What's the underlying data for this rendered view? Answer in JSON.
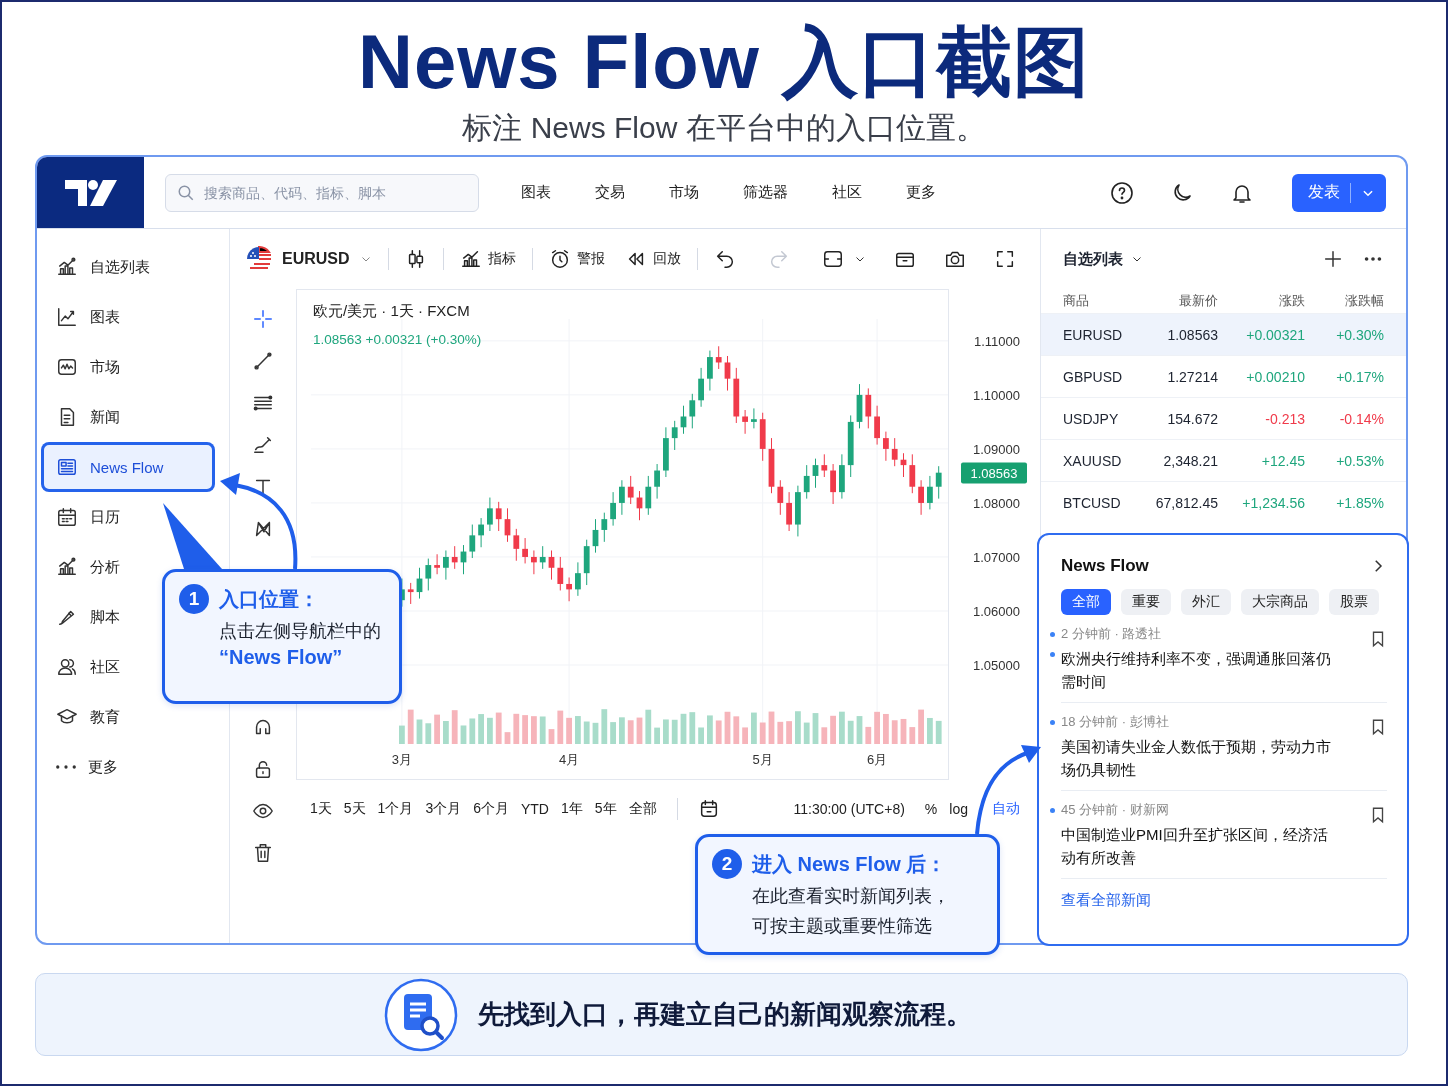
{
  "header": {
    "title": "News Flow 入口截图",
    "subtitle": "标注 News Flow 在平台中的入口位置。"
  },
  "topbar": {
    "search": {
      "placeholder": "搜索商品、代码、指标、脚本"
    },
    "nav": [
      "图表",
      "交易",
      "市场",
      "筛选器",
      "社区",
      "更多"
    ],
    "publish_button": "发表"
  },
  "sidebar": {
    "items": [
      {
        "kind": "watchlist",
        "label": "自选列表",
        "selected": false
      },
      {
        "kind": "chart",
        "label": "图表",
        "selected": false
      },
      {
        "kind": "market",
        "label": "市场",
        "selected": false
      },
      {
        "kind": "news",
        "label": "新闻",
        "selected": false
      },
      {
        "kind": "newsflow",
        "label": "News Flow",
        "selected": true
      },
      {
        "kind": "calendar",
        "label": "日历",
        "selected": false
      },
      {
        "kind": "analysis",
        "label": "分析",
        "selected": false
      },
      {
        "kind": "script",
        "label": "脚本",
        "selected": false
      },
      {
        "kind": "community",
        "label": "社区",
        "selected": false
      },
      {
        "kind": "education",
        "label": "教育",
        "selected": false
      },
      {
        "kind": "more",
        "label": "更多",
        "selected": false
      }
    ]
  },
  "chart_toolbar": {
    "symbol": "EURUSD",
    "indicators": "指标",
    "alert": "警报",
    "replay": "回放",
    "undo": {
      "disabled": false
    },
    "redo": {
      "disabled": true
    }
  },
  "drawing_tools": [
    {
      "kind": "crosshair",
      "selected": true
    },
    {
      "kind": "trendline",
      "selected": false
    },
    {
      "kind": "fib",
      "selected": false
    },
    {
      "kind": "brush",
      "selected": false
    },
    {
      "kind": "text",
      "selected": false
    },
    {
      "kind": "pattern",
      "selected": false
    },
    {
      "kind": "magnet",
      "selected": false
    },
    {
      "kind": "lock",
      "selected": false
    },
    {
      "kind": "eye",
      "selected": false
    },
    {
      "kind": "trash",
      "selected": false
    }
  ],
  "chart": {
    "title": "欧元/美元 · 1天 · FXCM",
    "price": "1.08563",
    "change": "+0.00321 (+0.30%)",
    "last_price": "1.08563",
    "chart_data": {
      "type": "candlestick",
      "ylim": [
        1.0289,
        1.1196
      ],
      "grid": true,
      "yticks": [
        {
          "value": 1.11,
          "label": "1.11000"
        },
        {
          "value": 1.1,
          "label": "1.10000"
        },
        {
          "value": 1.09,
          "label": "1.09000"
        },
        {
          "value": 1.08,
          "label": "1.08000"
        },
        {
          "value": 1.07,
          "label": "1.07000"
        },
        {
          "value": 1.06,
          "label": "1.06000"
        },
        {
          "value": 1.05,
          "label": "1.05000"
        }
      ],
      "categories": [
        "3月",
        null,
        null,
        null,
        null,
        null,
        null,
        null,
        null,
        null,
        null,
        null,
        null,
        null,
        null,
        null,
        null,
        null,
        null,
        "4月",
        null,
        null,
        null,
        null,
        null,
        null,
        null,
        null,
        null,
        null,
        null,
        null,
        null,
        null,
        null,
        null,
        null,
        null,
        null,
        null,
        null,
        "5月",
        null,
        null,
        null,
        null,
        null,
        null,
        null,
        null,
        null,
        null,
        null,
        null,
        "6月",
        null,
        null,
        null,
        null,
        null,
        null,
        null
      ],
      "ohlc": [
        [
          1.062,
          1.066,
          1.0608,
          1.064
        ],
        [
          1.064,
          1.0652,
          1.0613,
          1.0635
        ],
        [
          1.0635,
          1.068,
          1.0623,
          1.066
        ],
        [
          1.066,
          1.0697,
          1.0638,
          1.0685
        ],
        [
          1.0685,
          1.0705,
          1.0668,
          1.068
        ],
        [
          1.068,
          1.0712,
          1.0658,
          1.07
        ],
        [
          1.07,
          1.072,
          1.0678,
          1.069
        ],
        [
          1.069,
          1.0722,
          1.0668,
          1.071
        ],
        [
          1.071,
          1.076,
          1.0698,
          1.074
        ],
        [
          1.074,
          1.0772,
          1.0718,
          1.076
        ],
        [
          1.076,
          1.081,
          1.0748,
          1.079
        ],
        [
          1.079,
          1.0802,
          1.0748,
          1.077
        ],
        [
          1.077,
          1.079,
          1.0728,
          1.074
        ],
        [
          1.074,
          1.0752,
          1.0693,
          1.0715
        ],
        [
          1.0715,
          1.0735,
          1.0688,
          1.07
        ],
        [
          1.07,
          1.0712,
          1.0668,
          1.069
        ],
        [
          1.069,
          1.072,
          1.0678,
          1.07
        ],
        [
          1.07,
          1.0712,
          1.0658,
          1.068
        ],
        [
          1.068,
          1.07,
          1.0638,
          1.065
        ],
        [
          1.065,
          1.0662,
          1.0618,
          1.064
        ],
        [
          1.064,
          1.069,
          1.0628,
          1.067
        ],
        [
          1.067,
          1.0732,
          1.0648,
          1.072
        ],
        [
          1.072,
          1.077,
          1.0708,
          1.075
        ],
        [
          1.075,
          1.0782,
          1.0728,
          1.077
        ],
        [
          1.077,
          1.082,
          1.0758,
          1.08
        ],
        [
          1.08,
          1.0842,
          1.0778,
          1.083
        ],
        [
          1.083,
          1.085,
          1.0798,
          1.081
        ],
        [
          1.081,
          1.0822,
          1.0768,
          1.079
        ],
        [
          1.079,
          1.085,
          1.0778,
          1.083
        ],
        [
          1.083,
          1.0872,
          1.0808,
          1.086
        ],
        [
          1.086,
          1.094,
          1.0848,
          1.092
        ],
        [
          1.092,
          1.0952,
          1.0898,
          1.094
        ],
        [
          1.094,
          1.098,
          1.0928,
          1.096
        ],
        [
          1.096,
          1.1002,
          1.0938,
          1.099
        ],
        [
          1.099,
          1.105,
          1.0978,
          1.103
        ],
        [
          1.103,
          1.1082,
          1.1008,
          1.107
        ],
        [
          1.107,
          1.109,
          1.1048,
          1.106
        ],
        [
          1.106,
          1.1072,
          1.1008,
          1.103
        ],
        [
          1.103,
          1.105,
          1.0948,
          1.096
        ],
        [
          1.096,
          1.0972,
          1.0928,
          1.095
        ],
        [
          1.095,
          1.0975,
          1.0938,
          1.0955
        ],
        [
          1.0955,
          1.0967,
          1.0878,
          1.09
        ],
        [
          1.09,
          1.092,
          1.0818,
          1.083
        ],
        [
          1.083,
          1.0842,
          1.0778,
          1.08
        ],
        [
          1.08,
          1.082,
          1.0748,
          1.076
        ],
        [
          1.076,
          1.0832,
          1.0738,
          1.082
        ],
        [
          1.082,
          1.087,
          1.0808,
          1.085
        ],
        [
          1.085,
          1.0882,
          1.0828,
          1.087
        ],
        [
          1.087,
          1.089,
          1.0848,
          1.086
        ],
        [
          1.086,
          1.0872,
          1.0798,
          1.082
        ],
        [
          1.082,
          1.089,
          1.0808,
          1.087
        ],
        [
          1.087,
          1.0962,
          1.0848,
          1.095
        ],
        [
          1.095,
          1.102,
          1.0938,
          1.1
        ],
        [
          1.1,
          1.1012,
          1.0938,
          1.096
        ],
        [
          1.096,
          1.098,
          1.0908,
          1.092
        ],
        [
          1.092,
          1.0932,
          1.0878,
          1.09
        ],
        [
          1.09,
          1.092,
          1.0868,
          1.088
        ],
        [
          1.088,
          1.0892,
          1.0848,
          1.087
        ],
        [
          1.087,
          1.089,
          1.0818,
          1.083
        ],
        [
          1.083,
          1.0842,
          1.0778,
          1.08
        ],
        [
          1.08,
          1.085,
          1.0788,
          1.083
        ],
        [
          1.083,
          1.0868,
          1.0808,
          1.0856
        ]
      ]
    }
  },
  "range_bar": {
    "ranges": [
      "1天",
      "5天",
      "1个月",
      "3个月",
      "6个月",
      "YTD",
      "1年",
      "5年",
      "全部"
    ],
    "time": "11:30:00 (UTC+8)",
    "percent": "%",
    "log": "log",
    "auto": {
      "label": "自动",
      "selected": true
    }
  },
  "watchlist": {
    "title": "自选列表",
    "columns": [
      "商品",
      "最新价",
      "涨跌",
      "涨跌幅"
    ],
    "rows": [
      {
        "symbol": "EURUSD",
        "price": "1.08563",
        "change": "+0.00321",
        "percent": "+0.30%",
        "color": "#1ea67d",
        "selected": true
      },
      {
        "symbol": "GBPUSD",
        "price": "1.27214",
        "change": "+0.00210",
        "percent": "+0.17%",
        "color": "#1ea67d",
        "selected": false
      },
      {
        "symbol": "USDJPY",
        "price": "154.672",
        "change": "-0.213",
        "percent": "-0.14%",
        "color": "#f03a4a",
        "selected": false
      },
      {
        "symbol": "XAUUSD",
        "price": "2,348.21",
        "change": "+12.45",
        "percent": "+0.53%",
        "color": "#1ea67d",
        "selected": false
      },
      {
        "symbol": "BTCUSD",
        "price": "67,812.45",
        "change": "+1,234.56",
        "percent": "+1.85%",
        "color": "#1ea67d",
        "selected": false
      }
    ]
  },
  "news_flow": {
    "title": "News Flow",
    "filters": [
      {
        "label": "全部",
        "selected": true
      },
      {
        "label": "重要",
        "selected": false
      },
      {
        "label": "外汇",
        "selected": false
      },
      {
        "label": "大宗商品",
        "selected": false
      },
      {
        "label": "股票",
        "selected": false
      }
    ],
    "items": [
      {
        "meta": "2 分钟前 · 路透社",
        "headline": "欧洲央行维持利率不变，强调通胀回落仍需时间",
        "unread": true
      },
      {
        "meta": "18 分钟前 · 彭博社",
        "headline": "美国初请失业金人数低于预期，劳动力市场仍具韧性",
        "unread": false
      },
      {
        "meta": "45 分钟前 · 财新网",
        "headline": "中国制造业PMI回升至扩张区间，经济活动有所改善",
        "unread": false
      }
    ],
    "view_all": "查看全部新闻"
  },
  "callouts": [
    {
      "number": "1",
      "title": "入口位置：",
      "body_lines": [
        "点击左侧导航栏中的"
      ],
      "highlight": "“News Flow”"
    },
    {
      "number": "2",
      "title": "进入 News Flow 后：",
      "body_lines": [
        "在此查看实时新闻列表，",
        "可按主题或重要性筛选"
      ]
    }
  ],
  "footer": {
    "text": "先找到入口，再建立自己的新闻观察流程。"
  }
}
